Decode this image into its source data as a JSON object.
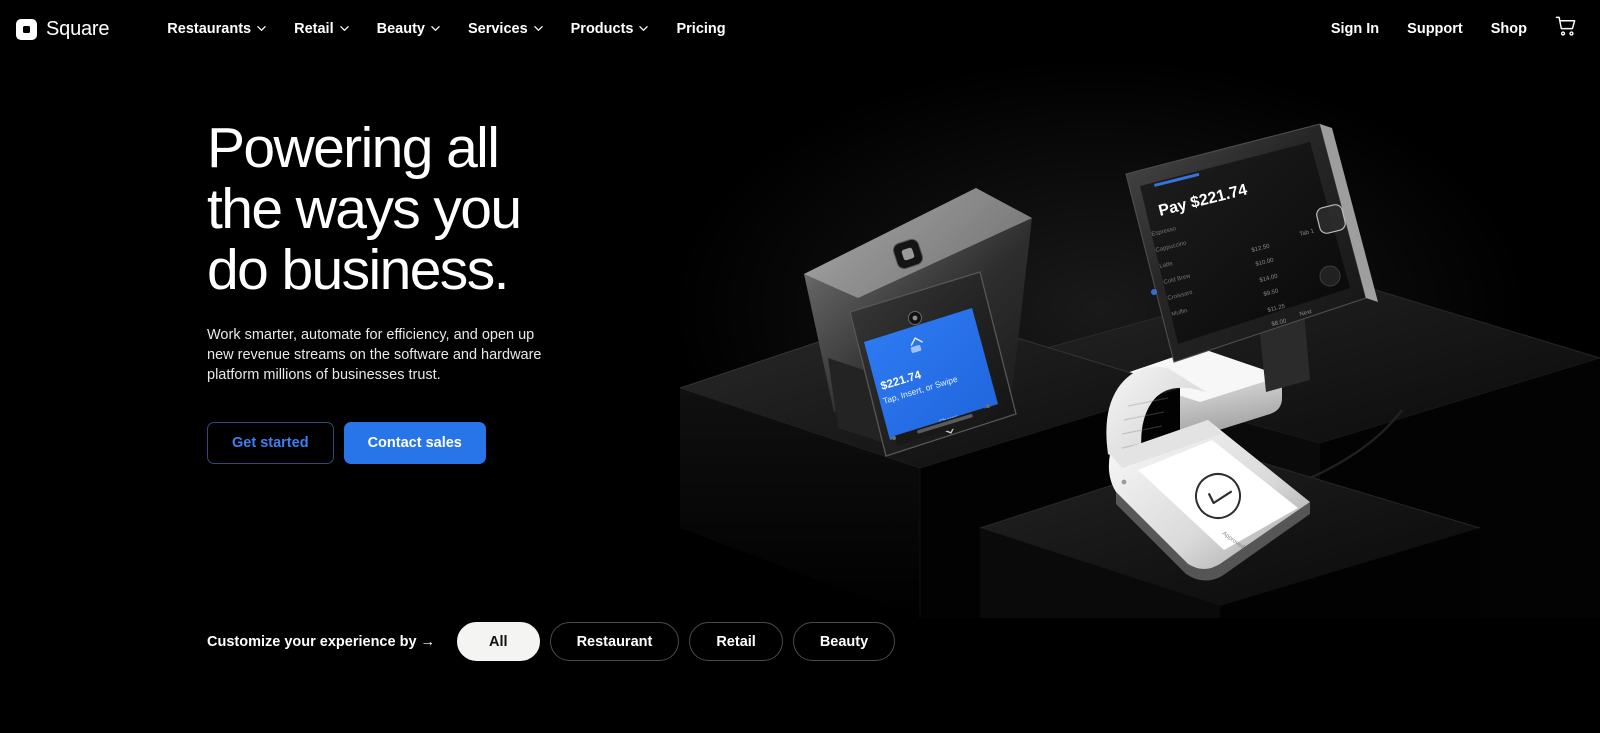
{
  "brand": {
    "name": "Square",
    "logo_icon": "square-logo-icon"
  },
  "nav": {
    "items": [
      {
        "label": "Restaurants",
        "has_dropdown": true
      },
      {
        "label": "Retail",
        "has_dropdown": true
      },
      {
        "label": "Beauty",
        "has_dropdown": true
      },
      {
        "label": "Services",
        "has_dropdown": true
      },
      {
        "label": "Products",
        "has_dropdown": true
      },
      {
        "label": "Pricing",
        "has_dropdown": false
      }
    ],
    "right": [
      {
        "label": "Sign In"
      },
      {
        "label": "Support"
      },
      {
        "label": "Shop"
      }
    ],
    "cart_icon": "shopping-cart-icon"
  },
  "hero": {
    "title": "Powering all\nthe ways you\ndo business.",
    "subtitle": "Work smarter, automate for efficiency, and open up new revenue streams on the software and hardware platform millions of businesses trust.",
    "cta_primary": "Contact sales",
    "cta_secondary": "Get started"
  },
  "artwork": {
    "terminal_amount": "$221.74",
    "terminal_prompt": "Tap, Insert, or Swipe",
    "terminal_footer": "Charge",
    "register_title": "Pay $221.74",
    "register_tab": "Tab 1",
    "register_next": "Next",
    "register_items": [
      {
        "name": "Espresso",
        "price": "$12.50"
      },
      {
        "name": "Cappuccino",
        "price": "$10.00"
      },
      {
        "name": "Latte",
        "price": "$14.00"
      },
      {
        "name": "Cold Brew",
        "price": "$9.50"
      },
      {
        "name": "Croissant",
        "price": "$11.25"
      },
      {
        "name": "Muffin",
        "price": "$8.00"
      }
    ],
    "handheld_icon": "check-circle-icon",
    "handheld_label": "Approved"
  },
  "filters": {
    "label": "Customize your experience by →",
    "options": [
      {
        "label": "All",
        "active": true
      },
      {
        "label": "Restaurant",
        "active": false
      },
      {
        "label": "Retail",
        "active": false
      },
      {
        "label": "Beauty",
        "active": false
      }
    ]
  },
  "colors": {
    "background": "#000000",
    "accent_blue": "#2775e8",
    "link_blue": "#3d7ff0",
    "pill_active_bg": "#f4f4f2",
    "text": "#ffffff"
  }
}
